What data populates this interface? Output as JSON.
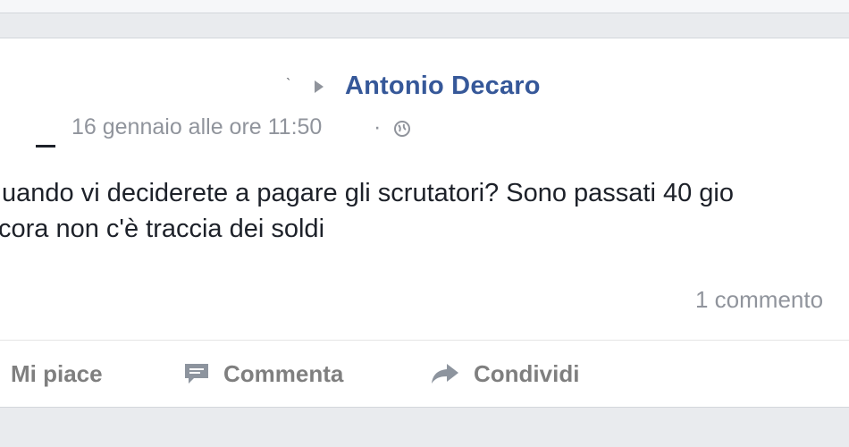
{
  "post": {
    "arrow_glyph": "`",
    "target_name": "Antonio Decaro",
    "timestamp": "16 gennaio alle ore 11:50",
    "separator": "·",
    "text_line1": "uando vi deciderete a pagare gli scrutatori? Sono passati 40 gio",
    "text_line2": "cora non c'è traccia dei soldi",
    "comments_count": "1 commento"
  },
  "actions": {
    "like_label": "Mi piace",
    "comment_label": "Commenta",
    "share_label": "Condividi"
  },
  "colors": {
    "link_blue": "#365899",
    "meta_gray": "#90949c",
    "text_dark": "#1d2129",
    "action_gray": "#7f7f7f",
    "background": "#e9ebee"
  },
  "icons": {
    "audience": "globe-icon",
    "comment": "comment-bubble-icon",
    "share": "share-arrow-icon",
    "target_separator": "triangle-right-icon"
  }
}
